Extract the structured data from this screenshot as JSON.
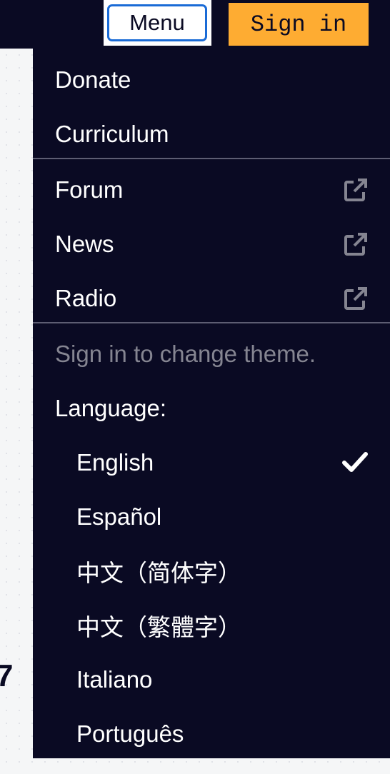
{
  "header": {
    "menu_label": "Menu",
    "signin_label": "Sign in"
  },
  "menu": {
    "primary": [
      {
        "label": "Donate"
      },
      {
        "label": "Curriculum"
      }
    ],
    "external": [
      {
        "label": "Forum",
        "icon": "external-link-icon"
      },
      {
        "label": "News",
        "icon": "external-link-icon"
      },
      {
        "label": "Radio",
        "icon": "external-link-icon"
      }
    ],
    "theme_note": "Sign in to change theme.",
    "language_heading": "Language:",
    "languages": [
      {
        "label": "English",
        "selected": true
      },
      {
        "label": "Español",
        "selected": false
      },
      {
        "label": "中文（简体字）",
        "selected": false
      },
      {
        "label": "中文（繁體字）",
        "selected": false
      },
      {
        "label": "Italiano",
        "selected": false
      },
      {
        "label": "Português",
        "selected": false
      }
    ]
  },
  "colors": {
    "background": "#0a0a23",
    "signin_button": "#feac32",
    "menu_border": "#1a6bd6",
    "muted_text": "#858591"
  }
}
